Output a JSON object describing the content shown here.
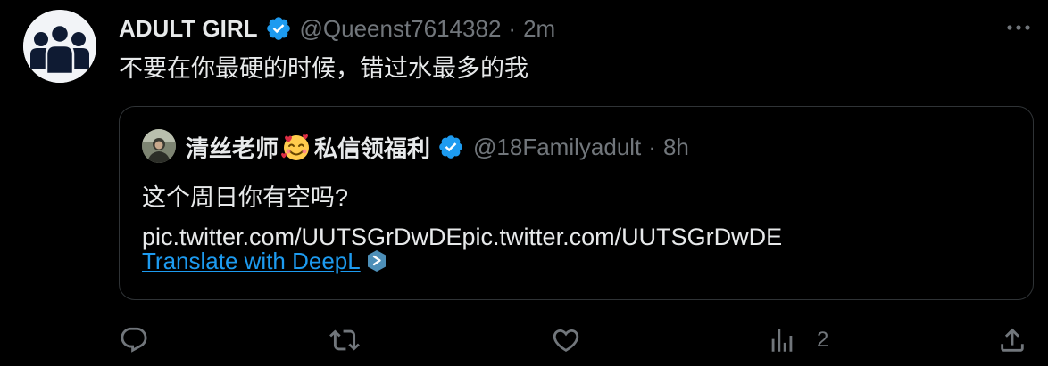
{
  "tweet": {
    "author": {
      "display_name": "ADULT GIRL",
      "handle": "@Queenst7614382",
      "verified": true,
      "avatar_icon": "group-people-icon"
    },
    "separator": "·",
    "timestamp": "2m",
    "text": "不要在你最硬的时候，错过水最多的我",
    "more_icon": "more-horizontal-icon"
  },
  "quoted_tweet": {
    "author": {
      "name_part1": "清丝老师",
      "name_emoji": "smiling-face-with-hearts-emoji",
      "name_part2": "私信领福利",
      "handle": "@18Familyadult",
      "verified": true
    },
    "separator": "·",
    "timestamp": "8h",
    "text_line1": "这个周日你有空吗?",
    "text_line2": "pic.twitter.com/UUTSGrDwDEpic.twitter.com/UUTSGrDwDE",
    "translate_label": "Translate with DeepL",
    "translate_icon": "deepl-icon"
  },
  "actions": {
    "reply_icon": "reply-icon",
    "retweet_icon": "retweet-icon",
    "like_icon": "like-icon",
    "views_icon": "views-icon",
    "views_count": "2",
    "share_icon": "share-icon"
  },
  "colors": {
    "background": "#000000",
    "primary_text": "#e7e9ea",
    "secondary_text": "#71767b",
    "link": "#1d9bf0",
    "verified_badge": "#1d9bf0",
    "border": "#2f3336"
  }
}
